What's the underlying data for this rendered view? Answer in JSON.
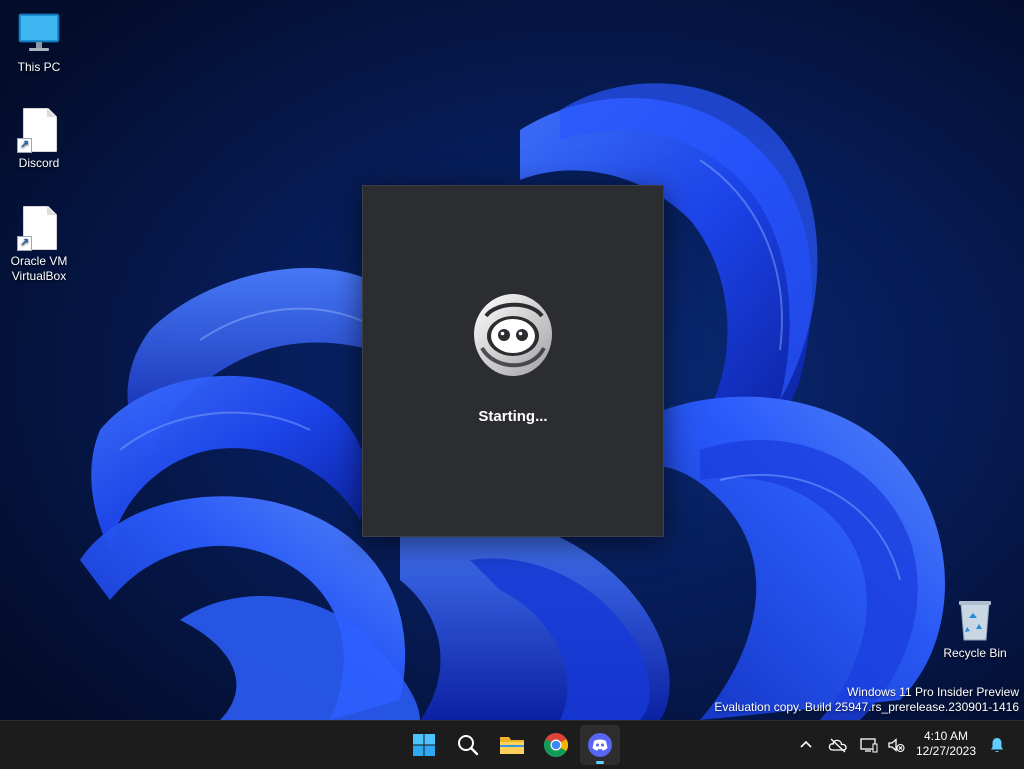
{
  "desktop": {
    "icons": [
      {
        "label": "This PC",
        "icon": "monitor-icon"
      },
      {
        "label": "Discord",
        "icon": "file-shortcut-icon"
      },
      {
        "label": "Oracle VM VirtualBox",
        "icon": "file-shortcut-icon"
      },
      {
        "label": "Recycle Bin",
        "icon": "recycle-bin-icon"
      }
    ],
    "watermark": {
      "line1": "Windows 11 Pro Insider Preview",
      "line2": "Evaluation copy. Build 25947.rs_prerelease.230901-1416"
    }
  },
  "splash": {
    "app": "Discord",
    "status": "Starting...",
    "logo_icon": "discord-loading-icon",
    "background": "#2b2d31"
  },
  "taskbar": {
    "apps": [
      {
        "name": "Start",
        "icon": "windows-start-icon",
        "active": false
      },
      {
        "name": "Search",
        "icon": "search-icon",
        "active": false
      },
      {
        "name": "File Explorer",
        "icon": "folder-icon",
        "active": false
      },
      {
        "name": "Google Chrome",
        "icon": "chrome-icon",
        "active": false
      },
      {
        "name": "Discord",
        "icon": "discord-icon",
        "active": true
      }
    ],
    "tray": {
      "icons": [
        "chevron-up-icon",
        "cloud-offline-icon",
        "network-icon",
        "volume-muted-icon",
        "notification-bell-icon"
      ]
    },
    "clock": {
      "time": "4:10 AM",
      "date": "12/27/2023"
    }
  },
  "colors": {
    "taskbar": "#1c1c1c",
    "accent": "#60cdff",
    "discord": "#5865f2",
    "wallpaper_bloom": "#1f4dff"
  }
}
